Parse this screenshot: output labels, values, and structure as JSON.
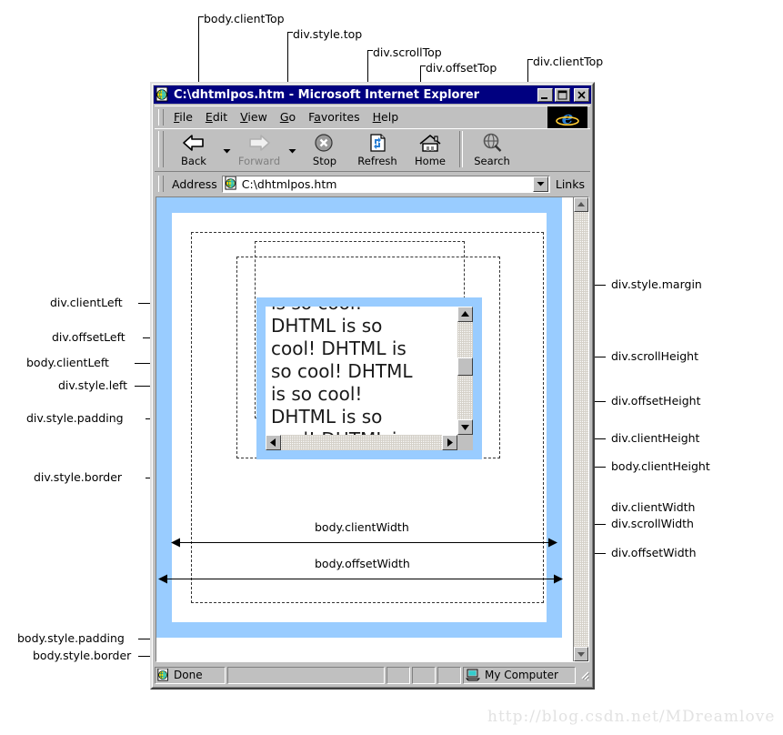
{
  "window": {
    "title": "C:\\dhtmlpos.htm - Microsoft Internet Explorer",
    "icon": "ie-document-icon",
    "buttons": {
      "minimize": "_",
      "maximize": "□",
      "close": "×"
    }
  },
  "menu": {
    "items": [
      {
        "label": "File",
        "accel": "F"
      },
      {
        "label": "Edit",
        "accel": "E"
      },
      {
        "label": "View",
        "accel": "V"
      },
      {
        "label": "Go",
        "accel": "G"
      },
      {
        "label": "Favorites",
        "accel": "a"
      },
      {
        "label": "Help",
        "accel": "H"
      }
    ],
    "logo": "ie-e-logo"
  },
  "toolbar": {
    "buttons": [
      {
        "label": "Back",
        "icon": "back-arrow-icon",
        "disabled": false,
        "dropdown": true
      },
      {
        "label": "Forward",
        "icon": "forward-arrow-icon",
        "disabled": true,
        "dropdown": true
      },
      {
        "label": "Stop",
        "icon": "stop-icon",
        "disabled": false,
        "dropdown": false
      },
      {
        "label": "Refresh",
        "icon": "refresh-icon",
        "disabled": false,
        "dropdown": false
      },
      {
        "label": "Home",
        "icon": "home-icon",
        "disabled": false,
        "dropdown": false
      },
      {
        "label": "Search",
        "icon": "search-icon",
        "disabled": false,
        "dropdown": false
      }
    ]
  },
  "address": {
    "label": "Address",
    "value": "C:\\dhtmlpos.htm",
    "placeholder": "",
    "icon": "ie-document-icon",
    "dropdown_icon": "chevron-down-icon",
    "links_label": "Links"
  },
  "status": {
    "text": "Done",
    "icon": "ie-document-icon",
    "zone": "My Computer",
    "zone_icon": "computer-icon"
  },
  "document": {
    "div_text": "is so cool! DHTML is so cool! DHTML is so cool! DHTML is so cool! DHTML is so cool! DHTML is so cool! DHTML is"
  },
  "colors": {
    "body_border": "#99ccff",
    "div_border": "#99ccff",
    "titlebar": "#000080",
    "chrome": "#c0c0c0",
    "watermark": "#e2e2e2"
  },
  "annotations": {
    "top": [
      {
        "id": "body-client-top",
        "label": "body.clientTop"
      },
      {
        "id": "div-style-top",
        "label": "div.style.top"
      },
      {
        "id": "div-scroll-top",
        "label": "div.scrollTop"
      },
      {
        "id": "div-offset-top",
        "label": "div.offsetTop"
      },
      {
        "id": "div-client-top",
        "label": "div.clientTop"
      }
    ],
    "left": [
      {
        "id": "div-client-left",
        "label": "div.clientLeft"
      },
      {
        "id": "div-offset-left",
        "label": "div.offsetLeft"
      },
      {
        "id": "body-client-left",
        "label": "body.clientLeft"
      },
      {
        "id": "div-style-left",
        "label": "div.style.left"
      },
      {
        "id": "div-style-padding",
        "label": "div.style.padding"
      },
      {
        "id": "div-style-border",
        "label": "div.style.border"
      }
    ],
    "right": [
      {
        "id": "div-style-margin",
        "label": "div.style.margin"
      },
      {
        "id": "div-scroll-height",
        "label": "div.scrollHeight"
      },
      {
        "id": "div-offset-height",
        "label": "div.offsetHeight"
      },
      {
        "id": "div-client-height",
        "label": "div.clientHeight"
      },
      {
        "id": "body-client-height",
        "label": "body.clientHeight"
      },
      {
        "id": "div-client-width",
        "label": "div.clientWidth"
      },
      {
        "id": "div-scroll-width",
        "label": "div.scrollWidth"
      },
      {
        "id": "div-offset-width",
        "label": "div.offsetWidth"
      }
    ],
    "inner": [
      {
        "id": "body-client-width",
        "label": "body.clientWidth"
      },
      {
        "id": "body-offset-width",
        "label": "body.offsetWidth"
      }
    ],
    "bottom": [
      {
        "id": "body-style-padding",
        "label": "body.style.padding"
      },
      {
        "id": "body-style-border",
        "label": "body.style.border"
      }
    ]
  },
  "watermark": "http://blog.csdn.net/MDreamlove"
}
